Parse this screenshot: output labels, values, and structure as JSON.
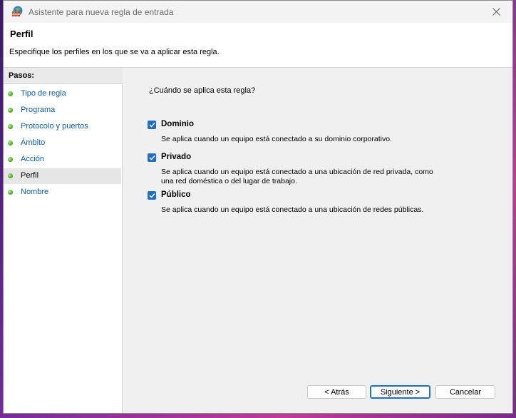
{
  "window": {
    "title": "Asistente para nueva regla de entrada"
  },
  "header": {
    "title": "Perfil",
    "description": "Especifique los perfiles en los que se va a aplicar esta regla."
  },
  "sidebar": {
    "heading": "Pasos:",
    "items": [
      {
        "label": "Tipo de regla"
      },
      {
        "label": "Programa"
      },
      {
        "label": "Protocolo y puertos"
      },
      {
        "label": "Ámbito"
      },
      {
        "label": "Acción"
      },
      {
        "label": "Perfil"
      },
      {
        "label": "Nombre"
      }
    ]
  },
  "main": {
    "question": "¿Cuándo se aplica esta regla?",
    "profiles": [
      {
        "label": "Dominio",
        "checked": true,
        "description": "Se aplica cuando un equipo está conectado a su dominio corporativo."
      },
      {
        "label": "Privado",
        "checked": true,
        "description": "Se aplica cuando un equipo está conectado a una ubicación de red privada, como una red doméstica o del lugar de trabajo."
      },
      {
        "label": "Público",
        "checked": true,
        "description": "Se aplica cuando un equipo está conectado a una ubicación de redes públicas."
      }
    ]
  },
  "buttons": {
    "back": "< Atrás",
    "next": "Siguiente >",
    "cancel": "Cancelar"
  },
  "colors": {
    "accent": "#1f6fc6",
    "link": "#0b5fb8",
    "step_dot": "#4fb531"
  },
  "icons": {
    "app": "firewall-wall-icon",
    "close": "close-icon",
    "check": "checkmark-icon"
  }
}
